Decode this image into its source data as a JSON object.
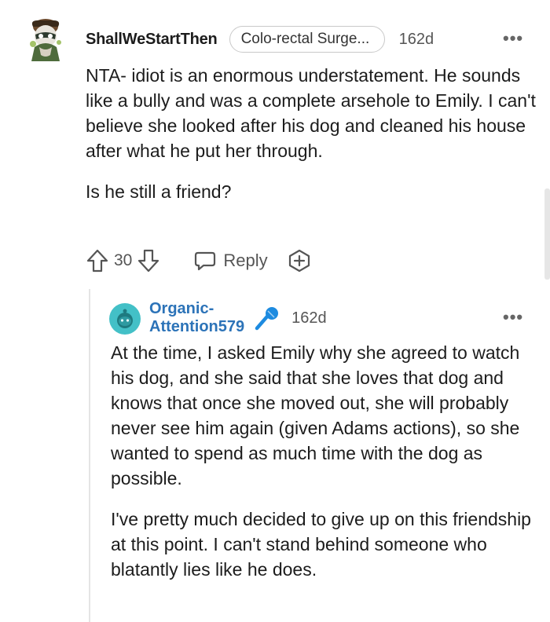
{
  "comment": {
    "username": "ShallWeStartThen",
    "flair": "Colo-rectal Surge...",
    "age": "162d",
    "more": "•••",
    "paragraphs": [
      "NTA- idiot is an enormous understatement. He sounds like a bully and was a complete arsehole to Emily. I can't believe she looked after his dog and cleaned his house after what he put her through.",
      "Is he still a friend?"
    ],
    "votes": "30",
    "reply_label": "Reply"
  },
  "reply": {
    "username": "Organic-Attention579",
    "age": "162d",
    "more": "•••",
    "paragraphs": [
      "At the time, I asked Emily why she agreed to watch his dog, and she said that she loves that dog and knows that once she moved out, she will probably never see him again (given Adams actions), so she wanted to spend as much time with the dog as possible.",
      "I've pretty much decided to give up on this friendship at this point. I can't stand behind someone who blatantly lies like he does."
    ]
  },
  "icons": {
    "upvote": "upvote-arrow-icon",
    "downvote": "downvote-arrow-icon",
    "reply": "speech-bubble-icon",
    "award": "award-plus-icon",
    "mic": "microphone-icon"
  },
  "colors": {
    "username_link": "#2c73b8",
    "mic": "#1d8be0",
    "avatar_teal": "#43c0c7"
  }
}
